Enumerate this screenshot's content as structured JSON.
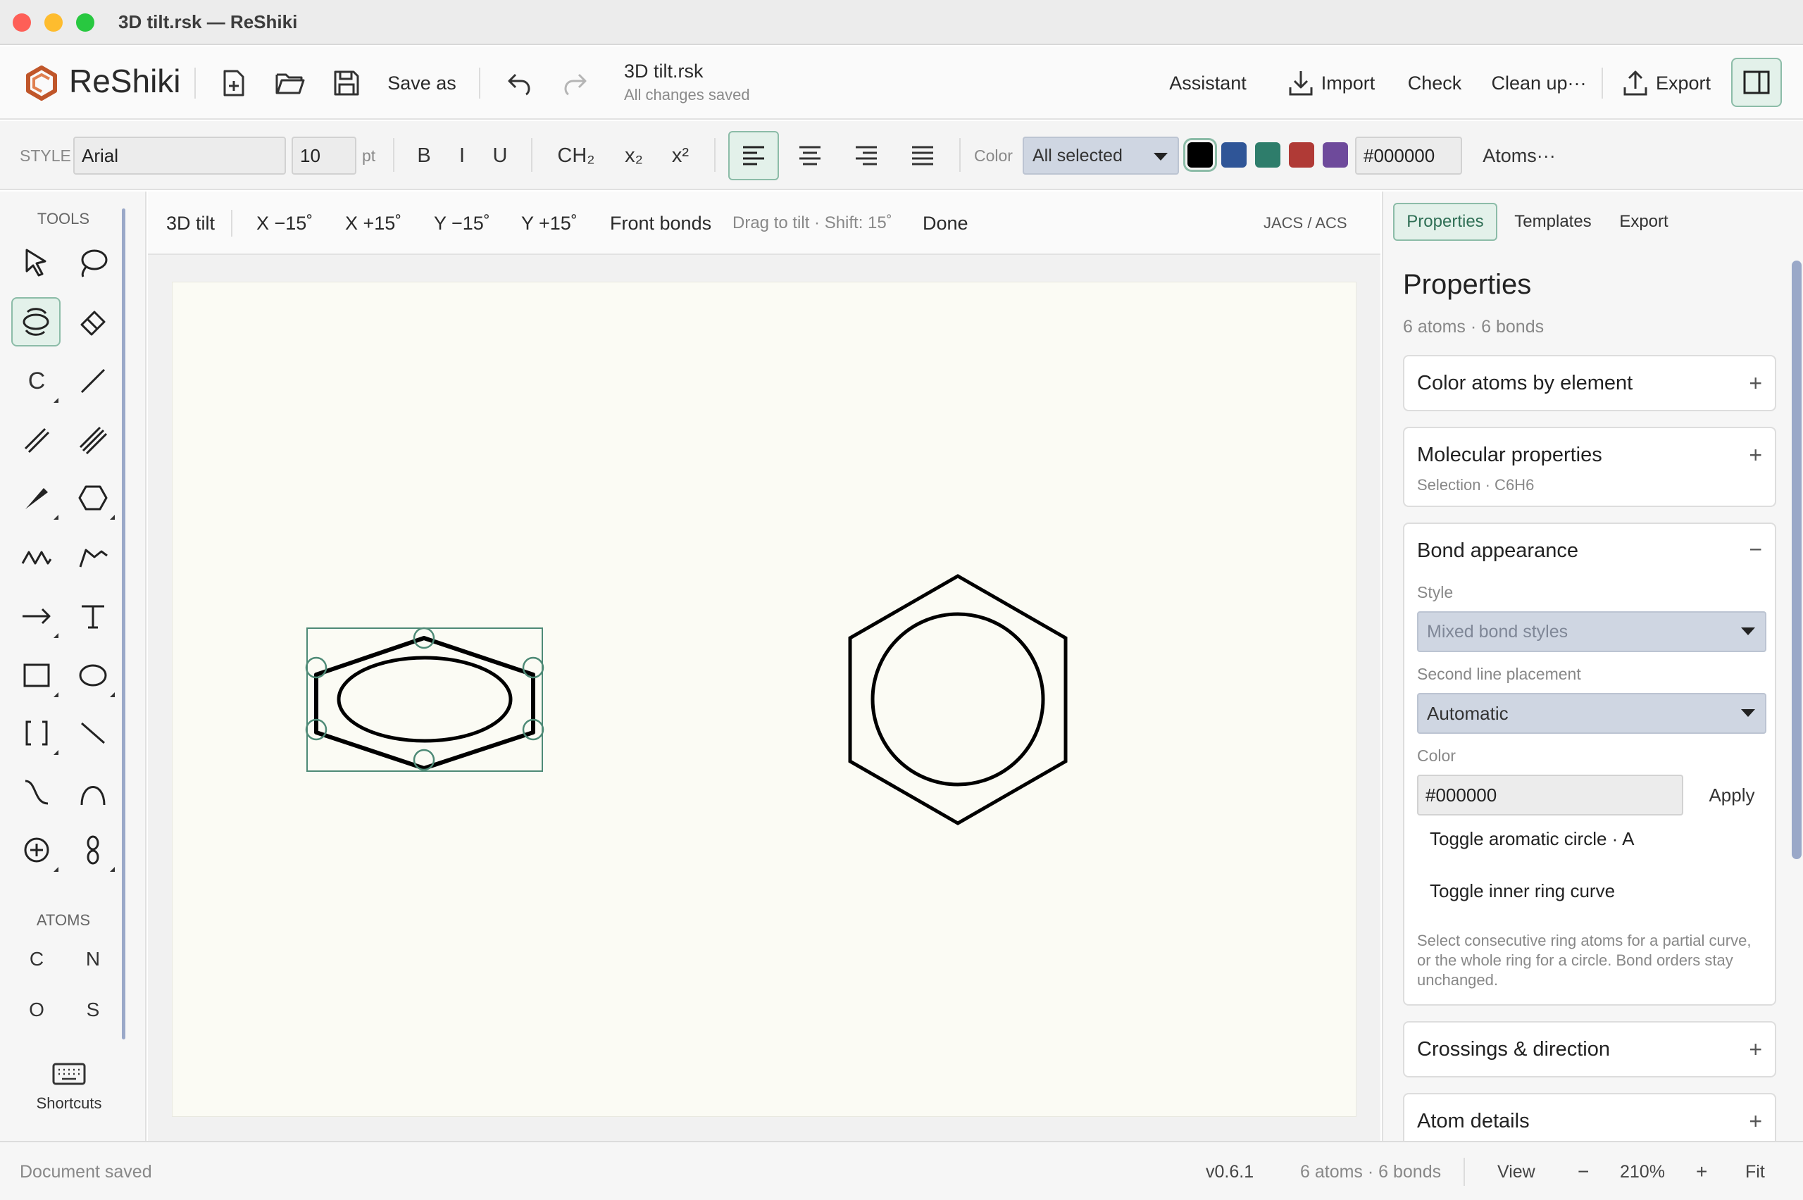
{
  "window": {
    "title": "3D tilt.rsk — ReShiki"
  },
  "app": {
    "name": "ReShiki"
  },
  "toolbar": {
    "save_as": "Save as",
    "doc_name": "3D tilt.rsk",
    "doc_status": "All changes saved",
    "assistant": "Assistant",
    "import": "Import",
    "check": "Check",
    "cleanup": "Clean up···",
    "export": "Export"
  },
  "format": {
    "style_label": "STYLE",
    "font_value": "Arial",
    "size_value": "10",
    "size_unit": "pt",
    "bold": "B",
    "italic": "I",
    "underline": "U",
    "ch2": "CH₂",
    "subscript": "x₂",
    "superscript": "x²",
    "color_label": "Color",
    "color_select": "All selected",
    "hex_value": "#000000",
    "atoms_menu": "Atoms···",
    "swatches": [
      "#000000",
      "#2f5597",
      "#2e7d6b",
      "#b03a36",
      "#6e4a9b"
    ],
    "accent": "#8cbca8"
  },
  "tools": {
    "section_label": "TOOLS",
    "atoms_label": "ATOMS",
    "carbon_tool": "C",
    "atoms": [
      "C",
      "N",
      "O",
      "S"
    ],
    "shortcuts": "Shortcuts"
  },
  "context_bar": {
    "mode": "3D tilt",
    "x_minus": "X −15˚",
    "x_plus": "X +15˚",
    "y_minus": "Y −15˚",
    "y_plus": "Y +15˚",
    "front_bonds": "Front bonds",
    "hint": "Drag to tilt · Shift: 15˚",
    "done": "Done",
    "style_preset": "JACS / ACS"
  },
  "right_panel": {
    "tabs": [
      "Properties",
      "Templates",
      "Export"
    ],
    "title": "Properties",
    "subtitle": "6 atoms · 6 bonds",
    "color_atoms": {
      "title": "Color atoms by element",
      "toggle": "+"
    },
    "molecular": {
      "title": "Molecular properties",
      "sub": "Selection · C6H6",
      "toggle": "+"
    },
    "bond": {
      "title": "Bond appearance",
      "toggle": "−",
      "style_label": "Style",
      "style_value": "Mixed bond styles",
      "placement_label": "Second line placement",
      "placement_value": "Automatic",
      "color_label": "Color",
      "color_value": "#000000",
      "apply": "Apply",
      "toggle_circle": "Toggle aromatic circle · A",
      "toggle_curve": "Toggle inner ring curve",
      "help": "Select consecutive ring atoms for a partial curve, or the whole ring for a circle. Bond orders stay unchanged."
    },
    "crossings": {
      "title": "Crossings & direction",
      "toggle": "+"
    },
    "atom_details": {
      "title": "Atom details",
      "toggle": "+"
    }
  },
  "status": {
    "left": "Document saved",
    "version": "v0.6.1",
    "counts": "6 atoms · 6 bonds",
    "view": "View",
    "zoom_out": "−",
    "zoom": "210%",
    "zoom_in": "+",
    "fit": "Fit"
  }
}
